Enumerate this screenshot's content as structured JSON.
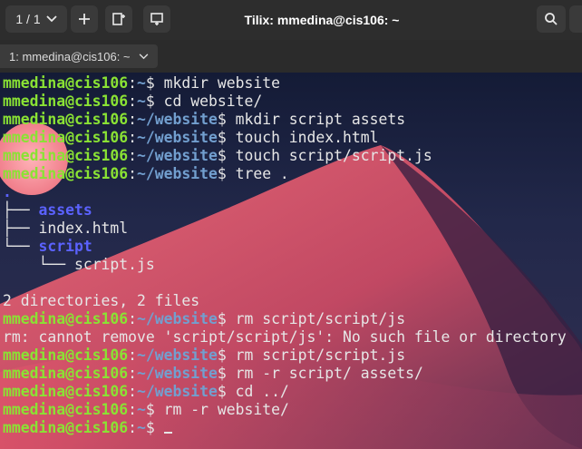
{
  "header": {
    "session_label": "1 / 1",
    "title": "Tilix: mmedina@cis106: ~"
  },
  "tab": {
    "label": "1: mmedina@cis106: ~"
  },
  "icons": {
    "add": "plus-icon",
    "split_right": "split-right-icon",
    "split_down": "split-down-icon",
    "search": "search-icon",
    "chevron": "chevron-down-icon"
  },
  "colors": {
    "prompt_user": "#8ae234",
    "prompt_path": "#729fcf",
    "directory": "#5b62ff",
    "background_top": "#141b36",
    "background_shape": "#e0576a"
  },
  "terminal": {
    "lines": [
      {
        "kind": "prompt",
        "user": "mmedina@cis106",
        "path": "~",
        "cmd": "mkdir website"
      },
      {
        "kind": "prompt",
        "user": "mmedina@cis106",
        "path": "~",
        "cmd": "cd website/"
      },
      {
        "kind": "prompt",
        "user": "mmedina@cis106",
        "path": "~/website",
        "cmd": "mkdir script assets"
      },
      {
        "kind": "prompt",
        "user": "mmedina@cis106",
        "path": "~/website",
        "cmd": "touch index.html"
      },
      {
        "kind": "prompt",
        "user": "mmedina@cis106",
        "path": "~/website",
        "cmd": "touch script/script.js"
      },
      {
        "kind": "prompt",
        "user": "mmedina@cis106",
        "path": "~/website",
        "cmd": "tree ."
      },
      {
        "kind": "tree",
        "prefix": "",
        "name": ".",
        "type": "dir"
      },
      {
        "kind": "tree",
        "prefix": "├── ",
        "name": "assets",
        "type": "dir"
      },
      {
        "kind": "tree",
        "prefix": "├── ",
        "name": "index.html",
        "type": "file"
      },
      {
        "kind": "tree",
        "prefix": "└── ",
        "name": "script",
        "type": "dir"
      },
      {
        "kind": "tree",
        "prefix": "    └── ",
        "name": "script.js",
        "type": "file"
      },
      {
        "kind": "blank"
      },
      {
        "kind": "output",
        "text": "2 directories, 2 files"
      },
      {
        "kind": "prompt",
        "user": "mmedina@cis106",
        "path": "~/website",
        "cmd": "rm script/script/js"
      },
      {
        "kind": "output",
        "text": "rm: cannot remove 'script/script/js': No such file or directory"
      },
      {
        "kind": "prompt",
        "user": "mmedina@cis106",
        "path": "~/website",
        "cmd": "rm script/script.js"
      },
      {
        "kind": "prompt",
        "user": "mmedina@cis106",
        "path": "~/website",
        "cmd": "rm -r script/ assets/"
      },
      {
        "kind": "prompt",
        "user": "mmedina@cis106",
        "path": "~/website",
        "cmd": "cd ../"
      },
      {
        "kind": "prompt",
        "user": "mmedina@cis106",
        "path": "~",
        "cmd": "rm -r website/"
      },
      {
        "kind": "prompt",
        "user": "mmedina@cis106",
        "path": "~",
        "cmd": "",
        "cursor": true
      }
    ]
  }
}
